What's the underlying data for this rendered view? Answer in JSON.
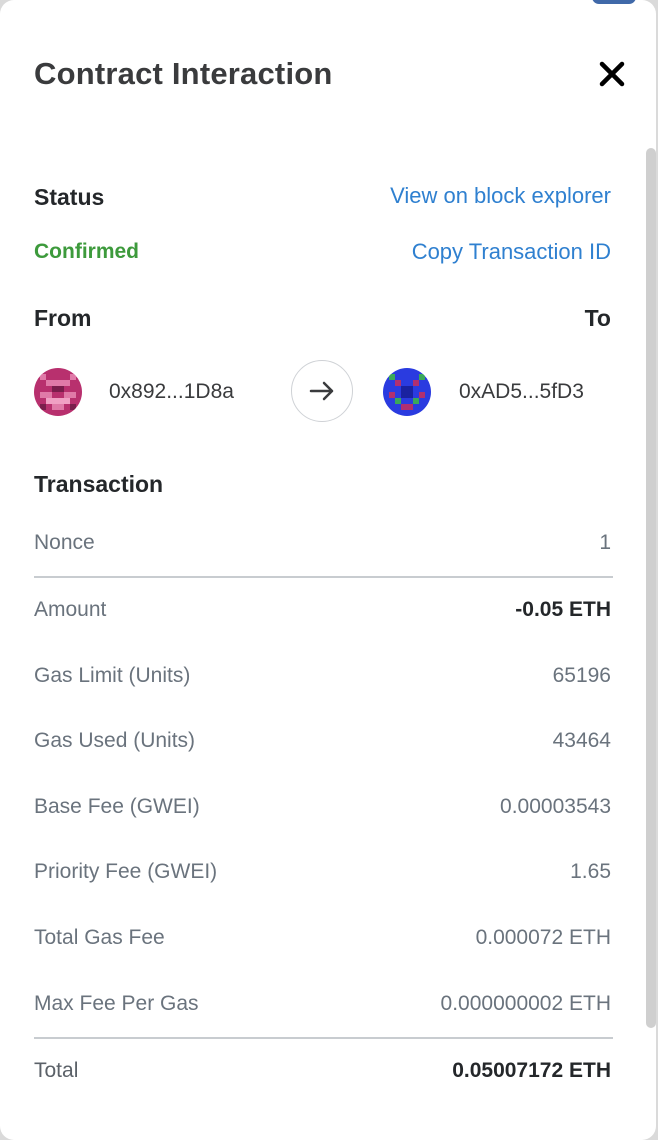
{
  "title": "Contract Interaction",
  "status": {
    "label": "Status",
    "value": "Confirmed",
    "value_color": "#3d9a3c",
    "explorer_link": "View on block explorer",
    "copy_link": "Copy Transaction ID"
  },
  "parties": {
    "from_label": "From",
    "to_label": "To",
    "from_address": "0x892...1D8a",
    "to_address": "0xAD5...5fD3",
    "arrow_icon": "arrow-right-icon"
  },
  "transaction": {
    "heading": "Transaction",
    "nonce": {
      "label": "Nonce",
      "value": "1"
    },
    "rows": [
      {
        "label": "Amount",
        "value": "-0.05 ETH"
      },
      {
        "label": "Gas Limit (Units)",
        "value": "65196"
      },
      {
        "label": "Gas Used (Units)",
        "value": "43464"
      },
      {
        "label": "Base Fee (GWEI)",
        "value": "0.00003543"
      },
      {
        "label": "Priority Fee (GWEI)",
        "value": "1.65"
      },
      {
        "label": "Total Gas Fee",
        "value": "0.000072 ETH"
      },
      {
        "label": "Max Fee Per Gas",
        "value": "0.000000002 ETH"
      }
    ],
    "total": {
      "label": "Total",
      "value": "0.05007172 ETH"
    }
  },
  "colors": {
    "link": "#2f80d0",
    "confirmed": "#3d9a3c",
    "text_primary": "#24272a",
    "text_secondary": "#6a737d"
  },
  "icons": {
    "close": "close-icon",
    "arrow": "arrow-right-icon"
  }
}
